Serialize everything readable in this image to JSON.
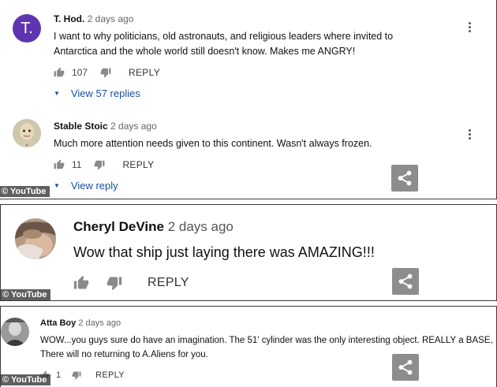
{
  "watermark": "© YouTube",
  "colors": {
    "link": "#1a4e9e",
    "avatar_letter_bg": "#5e35b1",
    "share_bg": "#8d8d8d"
  },
  "icons": {
    "like": "thumbs-up-icon",
    "dislike": "thumbs-down-icon",
    "more": "kebab-icon",
    "share": "share-icon",
    "expand": "caret-down-icon"
  },
  "comments": [
    {
      "avatar_letter": "T.",
      "author": "T. Hod.",
      "time": "2 days ago",
      "text": "I want to why politicians, old astronauts, and religious leaders where invited to Antarctica and the whole world still doesn't know. Makes me ANGRY!",
      "likes": "107",
      "reply_label": "REPLY",
      "view_replies": "View 57 replies"
    },
    {
      "author": "Stable Stoic",
      "time": "2 days ago",
      "text": "Much more attention needs given to this continent. Wasn't always frozen.",
      "likes": "11",
      "reply_label": "REPLY",
      "view_replies": "View reply"
    },
    {
      "author": "Cheryl DeVine",
      "time": "2 days ago",
      "text": "Wow that ship just laying there was AMAZING!!!",
      "reply_label": "REPLY"
    },
    {
      "author": "Atta Boy",
      "time": "2 days ago",
      "text": "WOW...you guys sure do have an imagination. The 51' cylinder was the only interesting object. REALLY a BASE, There will no returning to A.Aliens for you.",
      "likes": "1",
      "reply_label": "REPLY"
    }
  ]
}
